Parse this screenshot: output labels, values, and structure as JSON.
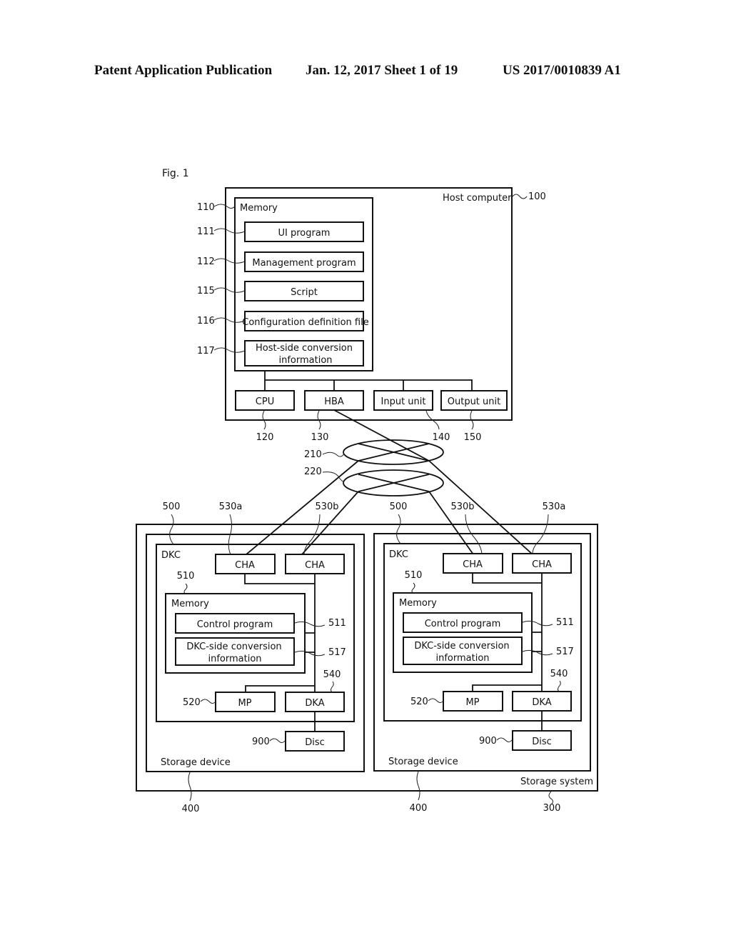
{
  "header": {
    "publication": "Patent Application Publication",
    "date_sheet": "Jan. 12, 2017  Sheet 1 of 19",
    "number": "US 2017/0010839 A1"
  },
  "figure": {
    "label": "Fig. 1",
    "host": {
      "title": "Host computer",
      "ref": "100",
      "memory": {
        "title": "Memory",
        "ref": "110",
        "items": [
          {
            "label": "UI program",
            "ref": "111"
          },
          {
            "label": "Management program",
            "ref": "112"
          },
          {
            "label": "Script",
            "ref": "115"
          },
          {
            "label": "Configuration definition file",
            "ref": "116"
          },
          {
            "label_line1": "Host-side conversion",
            "label_line2": "information",
            "ref": "117"
          }
        ]
      },
      "units": [
        {
          "label": "CPU",
          "ref": "120"
        },
        {
          "label": "HBA",
          "ref": "130"
        },
        {
          "label": "Input unit",
          "ref": "140"
        },
        {
          "label": "Output unit",
          "ref": "150"
        }
      ]
    },
    "networks": [
      {
        "ref": "210"
      },
      {
        "ref": "220"
      }
    ],
    "storage_system": {
      "title": "Storage system",
      "ref": "300",
      "devices": [
        {
          "title": "Storage device",
          "ref": "400",
          "dkc": {
            "title": "DKC",
            "ref": "500",
            "cha_left": {
              "label": "CHA",
              "ref": "530a"
            },
            "cha_right": {
              "label": "CHA",
              "ref": "530b"
            },
            "memory": {
              "title": "Memory",
              "ref": "510"
            },
            "control_program": {
              "label": "Control program",
              "ref": "511"
            },
            "conversion": {
              "label_line1": "DKC-side conversion",
              "label_line2": "information",
              "ref": "517"
            },
            "mp": {
              "label": "MP",
              "ref": "520"
            },
            "dka": {
              "label": "DKA",
              "ref": "540"
            }
          },
          "disc": {
            "label": "Disc",
            "ref": "900"
          }
        },
        {
          "title": "Storage device",
          "ref": "400",
          "dkc": {
            "title": "DKC",
            "ref": "500",
            "cha_left": {
              "label": "CHA",
              "ref": "530b"
            },
            "cha_right": {
              "label": "CHA",
              "ref": "530a"
            },
            "memory": {
              "title": "Memory",
              "ref": "510"
            },
            "control_program": {
              "label": "Control program",
              "ref": "511"
            },
            "conversion": {
              "label_line1": "DKC-side conversion",
              "label_line2": "information",
              "ref": "517"
            },
            "mp": {
              "label": "MP",
              "ref": "520"
            },
            "dka": {
              "label": "DKA",
              "ref": "540"
            }
          },
          "disc": {
            "label": "Disc",
            "ref": "900"
          }
        }
      ]
    }
  }
}
